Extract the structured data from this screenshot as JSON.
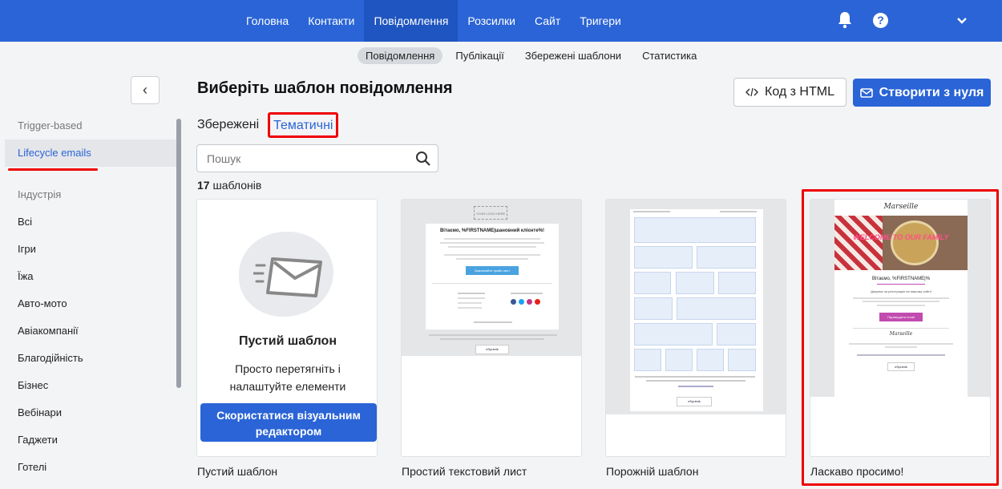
{
  "topnav": {
    "items": [
      "Головна",
      "Контакти",
      "Повідомлення",
      "Розсилки",
      "Сайт",
      "Тригери"
    ],
    "active": "Повідомлення"
  },
  "subnav": {
    "items": [
      "Повідомлення",
      "Публікації",
      "Збережені шаблони",
      "Статистика"
    ],
    "active": "Повідомлення"
  },
  "header": {
    "help_glyph": "?"
  },
  "sidebar": {
    "collapse_glyph": "‹",
    "items": [
      {
        "label": "Trigger-based",
        "type": "muted"
      },
      {
        "label": "Lifecycle emails",
        "type": "active"
      },
      {
        "label": "Індустрія",
        "type": "section"
      },
      {
        "label": "Всі"
      },
      {
        "label": "Ігри"
      },
      {
        "label": "Їжа"
      },
      {
        "label": "Авто-мото"
      },
      {
        "label": "Авіакомпанії"
      },
      {
        "label": "Благодійність"
      },
      {
        "label": "Бізнес"
      },
      {
        "label": "Вебінари"
      },
      {
        "label": "Гаджети"
      },
      {
        "label": "Готелі"
      }
    ]
  },
  "main": {
    "title": "Виберіть шаблон повідомлення",
    "html_button": "Код з HTML",
    "create_button": "Створити з нуля",
    "tabs": [
      "Збережені",
      "Тематичні"
    ],
    "active_tab": "Тематичні",
    "search_placeholder": "Пошук",
    "count_number": "17",
    "count_label": "шаблонів"
  },
  "cards": [
    {
      "caption": "Пустий шаблон",
      "title": "Пустий шаблон",
      "description": "Просто перетягніть і налаштуйте елементи",
      "button": "Скористатися візуальним редактором"
    },
    {
      "caption": "Простий текстовий лист",
      "logo": "YOUR LOGO HERE",
      "greeting": "Вітаємо, %FIRSTNAME|шановний клієнте%!",
      "cta": "Замовляйте прайс-лист",
      "brand": "eSputnik"
    },
    {
      "caption": "Порожній шаблон",
      "brand": "eSputnik"
    },
    {
      "caption": "Ласкаво просимо!",
      "logo": "Marseille",
      "banner": "WELCOME TO OUR FAMILY",
      "greeting": "Вітаємо, %FIRSTNAME|%",
      "line1": "Дякуємо за реєстрацію на нашому сайті!",
      "cta": "Підтвердити email",
      "brand": "eSputnik"
    }
  ],
  "colors": {
    "accent": "#2a64d6",
    "highlight": "#ee0000",
    "background": "#f3f4f6"
  }
}
